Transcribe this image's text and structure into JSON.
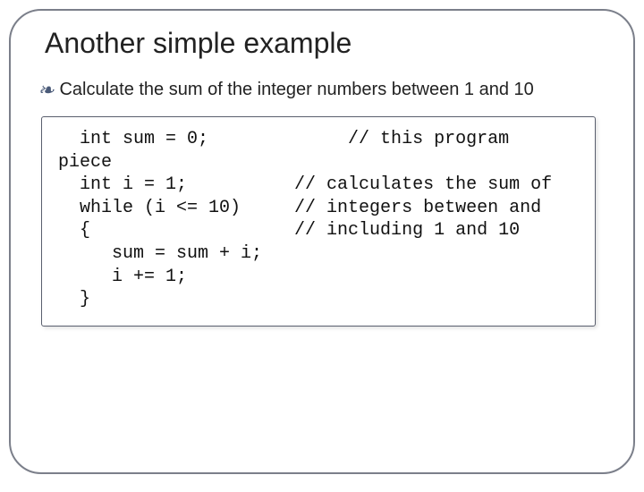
{
  "title": "Another simple example",
  "bullet": {
    "icon_glyph": "❧",
    "text": "Calculate the sum of the integer numbers between 1 and 10"
  },
  "code": {
    "lines": [
      "  int sum = 0;             // this program",
      "piece",
      "  int i = 1;          // calculates the sum of",
      "  while (i <= 10)     // integers between and",
      "  {                   // including 1 and 10",
      "     sum = sum + i;",
      "     i += 1;",
      "  }"
    ]
  }
}
